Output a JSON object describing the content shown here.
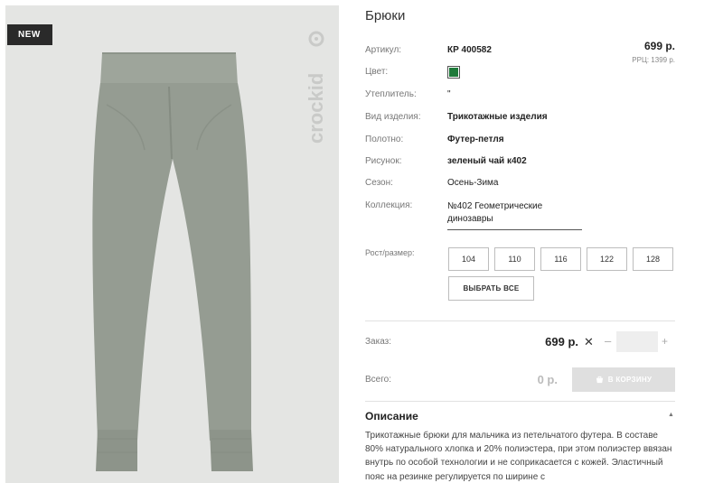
{
  "product": {
    "badge": "NEW",
    "brand": "crockid",
    "title": "Брюки",
    "price": "699 р.",
    "rrp": "РРЦ: 1399 р."
  },
  "attributes": {
    "article_label": "Артикул:",
    "article_value": "КР 400582",
    "color_label": "Цвет:",
    "color_hex": "#1f7a3a",
    "insulation_label": "Утеплитель:",
    "insulation_value": "\"",
    "type_label": "Вид изделия:",
    "type_value": "Трикотажные изделия",
    "fabric_label": "Полотно:",
    "fabric_value": "Футер-петля",
    "pattern_label": "Рисунок:",
    "pattern_value": "зеленый чай к402",
    "season_label": "Сезон:",
    "season_value": "Осень-Зима",
    "collection_label": "Коллекция:",
    "collection_value": "№402 Геометрические динозавры"
  },
  "sizes": {
    "label": "Рост/размер:",
    "options": [
      "104",
      "110",
      "116",
      "122",
      "128"
    ],
    "select_all": "ВЫБРАТЬ ВСЕ"
  },
  "order": {
    "label": "Заказ:",
    "price": "699 р.",
    "times": "✕",
    "minus": "–",
    "plus": "+",
    "quantity": ""
  },
  "total": {
    "label": "Всего:",
    "value": "0 р.",
    "cart_button": "В КОРЗИНУ"
  },
  "description": {
    "title": "Описание",
    "text": "Трикотажные брюки для мальчика из петельчатого футера. В составе 80% натурального хлопка и 20% полиэстера, при этом полиэстер ввязан внутрь по особой технологии и не соприкасается с кожей. Эластичный пояс на резинке регулируется по ширине с"
  }
}
